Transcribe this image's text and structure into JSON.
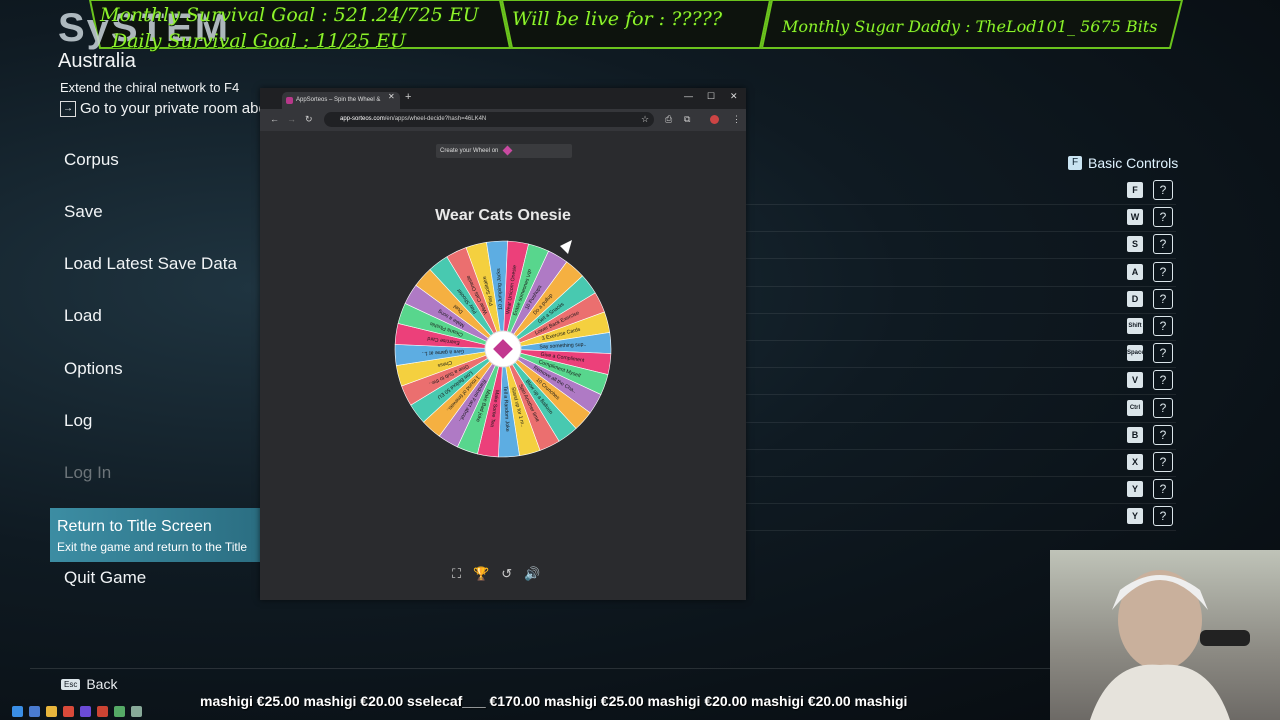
{
  "banner": {
    "monthly_goal": "Monthly Survival Goal : 521.24/725 EU",
    "daily_goal": "Daily Survival Goal : 11/25 EU",
    "live": "Will be live for :   ?????",
    "sugar": "Monthly Sugar Daddy : TheLod101_ 5675 Bits",
    "color": "#8ef22b"
  },
  "game": {
    "section_title": "SySTEM",
    "region": "Australia",
    "mission": "Extend the chiral network to F4",
    "mission2": "Go to your private room abo",
    "menu": [
      "Corpus",
      "Save",
      "Load Latest Save Data",
      "Load",
      "Options",
      "Log",
      "Log In"
    ],
    "selected": {
      "label": "Return to Title Screen",
      "desc": "Exit the game and return to the Title"
    },
    "quit": "Quit Game",
    "back_key": "Esc",
    "back_label": "Back",
    "controls_key": "F",
    "controls_title": "Basic Controls",
    "controls": [
      "F",
      "W",
      "S",
      "A",
      "D",
      "Shift",
      "Space",
      "V",
      "Ctrl",
      "B",
      "X",
      "Y",
      "Y"
    ]
  },
  "browser": {
    "tab_title": "AppSorteos – Spin the Wheel &",
    "url_host": "app-sorteos.com",
    "url_path": "/en/apps/wheel-decide?hash=46LK4N",
    "create_label": "Create your Wheel on",
    "wheel_title": "Wear Cats Onesie",
    "segments": [
      "Play Solitaire",
      "10 Jumping Jacks",
      "Wear Unicorn Onesie",
      "Erase someones VIP",
      "10 Pushups",
      "Do a pullup",
      "Get a Snacks",
      "Lower Back Exercise",
      "3 Exercise Cards",
      "Say something sup..",
      "Give a Compliment",
      "Compliment Myself",
      "Remove all the Cha..",
      "10 Crunches",
      "Blow up a Balloon",
      "Spin Another time",
      "Stand up for 1 m..",
      "Tell a Random Joke",
      "Make Some Tea",
      "Make Bad joke",
      "Random Fact about..",
      "1 round of timewas..",
      "Low Bellout 50 EU",
      "Give a Sub to the..",
      "Chess",
      "Give a game at 1..",
      "Exercise Card",
      "Cleana Plushie",
      "Make a song",
      "Duel",
      "Play Shooter",
      "Wear Cats Onesie"
    ]
  },
  "ticker": "mashigi  €25.00    mashigi  €20.00    sselecaf___  €170.00    mashigi  €25.00    mashigi  €20.00    mashigi  €20.00    mashigi"
}
